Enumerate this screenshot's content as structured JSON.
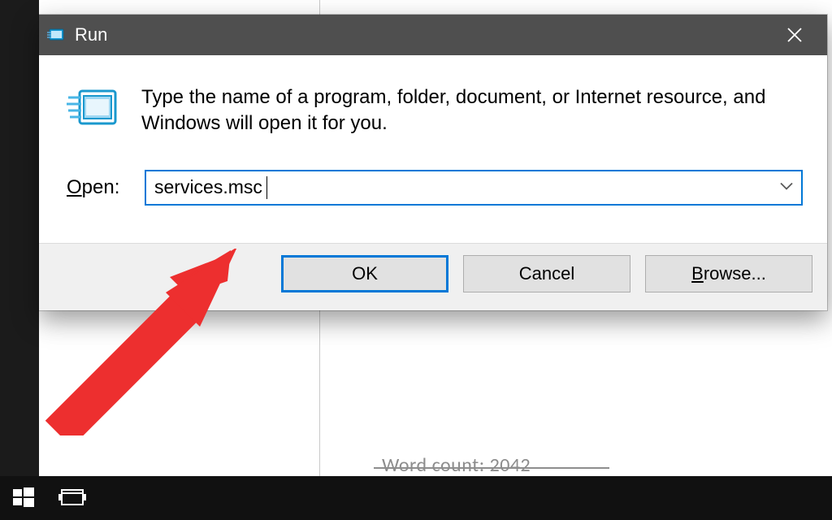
{
  "dialog": {
    "title": "Run",
    "description": "Type the name of a program, folder, document, or Internet resource, and Windows will open it for you.",
    "open_label_ul": "O",
    "open_label_rest": "pen:",
    "input_value": "services.msc",
    "buttons": {
      "ok": "OK",
      "cancel": "Cancel",
      "browse_ul": "B",
      "browse_rest": "rowse..."
    }
  },
  "background": {
    "word_count_text": "Word count: 2042"
  }
}
